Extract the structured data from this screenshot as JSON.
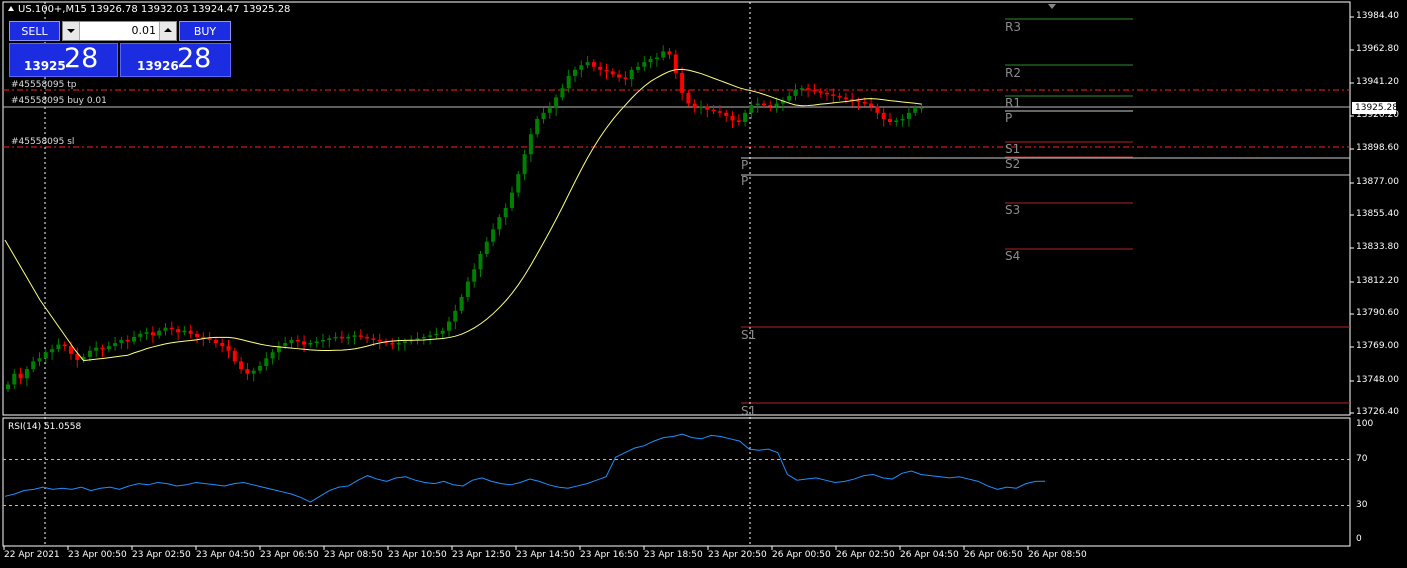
{
  "header": {
    "symbol_line": "US.100+,M15  13926.78 13932.03 13924.47 13925.28"
  },
  "trade_panel": {
    "sell_label": "SELL",
    "buy_label": "BUY",
    "lot_value": "0.01",
    "bid_base": "13925",
    "bid_big": "28",
    "ask_base": "13926",
    "ask_big": "28"
  },
  "order_labels": {
    "tp": "#45558095 tp",
    "buy": "#45558095 buy 0.01",
    "sl": "#45558095 sl"
  },
  "pivots": {
    "R3": "R3",
    "R2": "R2",
    "R1": "R1",
    "P": "P",
    "S1": "S1",
    "S2": "S2",
    "S3": "S3",
    "S4": "S4",
    "P_left1": "P",
    "P_left2": "P",
    "S1_left1": "S1",
    "S1_left2": "S1"
  },
  "y_axis": [
    "13984.40",
    "13962.80",
    "13941.20",
    "13920.20",
    "13898.60",
    "13877.00",
    "13855.40",
    "13833.80",
    "13812.20",
    "13790.60",
    "13769.00",
    "13748.00",
    "13726.40"
  ],
  "current_price": "13925.28",
  "rsi": {
    "label": "RSI(14) 51.0558",
    "axis": [
      "100",
      "70",
      "30",
      "0"
    ]
  },
  "x_axis": [
    "22 Apr 2021",
    "23 Apr 00:50",
    "23 Apr 02:50",
    "23 Apr 04:50",
    "23 Apr 06:50",
    "23 Apr 08:50",
    "23 Apr 10:50",
    "23 Apr 12:50",
    "23 Apr 14:50",
    "23 Apr 16:50",
    "23 Apr 18:50",
    "23 Apr 20:50",
    "26 Apr 00:50",
    "26 Apr 02:50",
    "26 Apr 04:50",
    "26 Apr 06:50",
    "26 Apr 08:50"
  ],
  "colors": {
    "bull": "#008000",
    "bear": "#ff0000",
    "ma": "#ffff80",
    "rsi": "#1e90ff",
    "panel": "#1c2ce0"
  },
  "chart_data": {
    "type": "candlestick",
    "price_range": [
      13726.4,
      13984.4
    ],
    "closes": [
      13745,
      13752,
      13749,
      13755,
      13760,
      13762,
      13766,
      13768,
      13771,
      13770,
      13765,
      13761,
      13763,
      13767,
      13769,
      13768,
      13770,
      13772,
      13774,
      13773,
      13776,
      13778,
      13779,
      13777,
      13780,
      13782,
      13781,
      13779,
      13780,
      13778,
      13776,
      13775,
      13774,
      13772,
      13770,
      13767,
      13760,
      13755,
      13752,
      13754,
      13757,
      13762,
      13766,
      13770,
      13772,
      13774,
      13773,
      13771,
      13772,
      13773,
      13774,
      13775,
      13776,
      13775,
      13776,
      13777,
      13776,
      13775,
      13774,
      13773,
      13772,
      13771,
      13772,
      13773,
      13774,
      13775,
      13776,
      13777,
      13778,
      13780,
      13786,
      13793,
      13802,
      13812,
      13820,
      13830,
      13838,
      13846,
      13854,
      13860,
      13870,
      13882,
      13895,
      13908,
      13918,
      13922,
      13925,
      13932,
      13938,
      13946,
      13950,
      13953,
      13955,
      13952,
      13950,
      13949,
      13947,
      13945,
      13944,
      13950,
      13952,
      13955,
      13957,
      13958,
      13962,
      13960,
      13948,
      13935,
      13928,
      13925,
      13926,
      13924,
      13923,
      13922,
      13920,
      13917,
      13916,
      13922,
      13927,
      13928,
      13927,
      13926,
      13928,
      13930,
      13933,
      13937,
      13938,
      13937,
      13936,
      13935,
      13934,
      13933,
      13932,
      13931,
      13930,
      13929,
      13928,
      13926,
      13922,
      13918,
      13916,
      13917,
      13918,
      13922,
      13925,
      13925.28
    ],
    "rsi_values": [
      38,
      40,
      43,
      44,
      46,
      44,
      45,
      44,
      46,
      43,
      45,
      46,
      44,
      47,
      49,
      48,
      50,
      49,
      47,
      48,
      50,
      49,
      48,
      47,
      49,
      50,
      48,
      46,
      44,
      42,
      40,
      37,
      33,
      38,
      43,
      46,
      47,
      52,
      56,
      53,
      51,
      54,
      55,
      52,
      50,
      49,
      51,
      48,
      47,
      52,
      54,
      51,
      49,
      48,
      50,
      53,
      51,
      48,
      46,
      45,
      47,
      49,
      52,
      55,
      72,
      76,
      80,
      82,
      86,
      89,
      90,
      92,
      89,
      88,
      91,
      90,
      88,
      86,
      79,
      78,
      79,
      76,
      57,
      52,
      53,
      54,
      52,
      50,
      51,
      53,
      56,
      57,
      54,
      53,
      58,
      60,
      57,
      56,
      55,
      54,
      55,
      53,
      51,
      47,
      44,
      46,
      45,
      49,
      51,
      51.0558
    ]
  }
}
